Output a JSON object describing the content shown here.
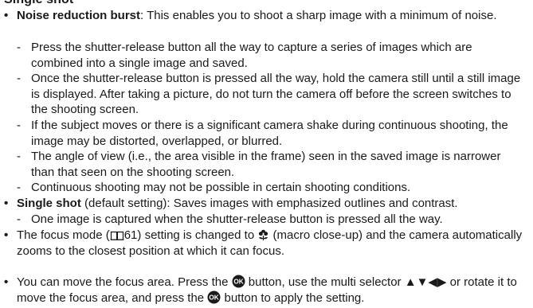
{
  "heading": "Single shot",
  "noise": {
    "title": "Noise reduction burst",
    "desc": ": This enables you to shoot a sharp image with a minimum of noise.",
    "subs": [
      "Press the shutter-release button all the way to capture a series of images which are combined into a single image and saved.",
      "Once the shutter-release button is pressed all the way, hold the camera still until a still image is displayed. After taking a picture, do not turn the camera off before the screen switches to the shooting screen.",
      "If the subject moves or there is a significant camera shake during continuous shooting, the image may be distorted, overlapped, or blurred.",
      "The angle of view (i.e., the area visible in the frame) seen in the saved image is narrower than that seen on the shooting screen.",
      "Continuous shooting may not be possible in certain shooting conditions."
    ]
  },
  "single": {
    "title": "Single shot",
    "desc": " (default setting): Saves images with emphasized outlines and contrast.",
    "subs": [
      "One image is captured when the shutter-release button is pressed all the way."
    ]
  },
  "focus": {
    "text1": "The focus mode (",
    "page_ref": "61",
    "text2": ") setting is changed to ",
    "text3": " (macro close-up) and the camera automatically zooms to the closest position at which it can focus."
  },
  "move": {
    "text1": "You can move the focus area. Press the ",
    "text2": " button, use the multi selector ",
    "arrows": "▲▼◀▶",
    "text3": " or rotate it to move the focus area, and press the ",
    "text4": " button to apply the setting."
  },
  "symbols": {
    "bullet": "•",
    "dash": "-"
  },
  "icons": {
    "book": "book-icon",
    "macro": "macro-flower-icon",
    "ok": "ok-button-icon"
  }
}
